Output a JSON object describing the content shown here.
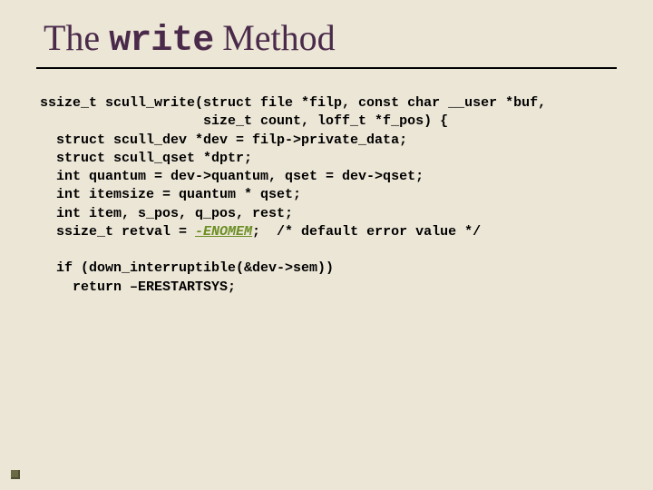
{
  "title": {
    "prefix": "The ",
    "mono": "write",
    "suffix": " Method"
  },
  "code": {
    "l1": "ssize_t scull_write(struct file *filp, const char __user *buf,",
    "l2": "                    size_t count, loff_t *f_pos) {",
    "l3": "  struct scull_dev *dev = filp->private_data;",
    "l4": "  struct scull_qset *dptr;",
    "l5": "  int quantum = dev->quantum, qset = dev->qset;",
    "l6": "  int itemsize = quantum * qset;",
    "l7": "  int item, s_pos, q_pos, rest;",
    "l8a": "  ssize_t retval = ",
    "l8b": "-ENOMEM",
    "l8c": ";  /* default error value */",
    "l9": "",
    "l10": "  if (down_interruptible(&dev->sem))",
    "l11": "    return –ERESTARTSYS;"
  }
}
